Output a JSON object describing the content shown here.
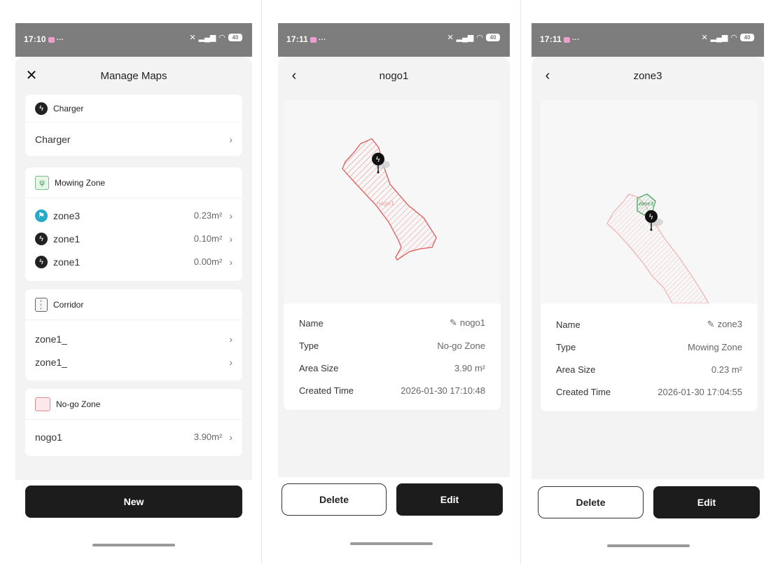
{
  "status_bar": {
    "panel1_time": "17:10",
    "panel2_time": "17:11",
    "panel3_time": "17:11",
    "dots": "···",
    "battery": "40"
  },
  "manage_maps": {
    "title": "Manage Maps",
    "charger": {
      "header": "Charger",
      "items": [
        {
          "label": "Charger"
        }
      ]
    },
    "mowing": {
      "header": "Mowing Zone",
      "items": [
        {
          "label": "zone3",
          "value": "0.23m²"
        },
        {
          "label": "zone1",
          "value": "0.10m²"
        },
        {
          "label": "zone1",
          "value": "0.00m²"
        }
      ]
    },
    "corridor": {
      "header": "Corridor",
      "items": [
        {
          "label": "zone1_"
        },
        {
          "label": "zone1_"
        }
      ]
    },
    "nogo": {
      "header": "No-go Zone",
      "items": [
        {
          "label": "nogo1",
          "value": "3.90m²"
        }
      ]
    },
    "new_button": "New"
  },
  "detail_nogo": {
    "title": "nogo1",
    "map_label": "nogo1",
    "fields": [
      {
        "label": "Name",
        "value": "nogo1"
      },
      {
        "label": "Type",
        "value": "No-go Zone"
      },
      {
        "label": "Area Size",
        "value": "3.90 m²"
      },
      {
        "label": "Created Time",
        "value": "2026-01-30 17:10:48"
      }
    ],
    "delete_button": "Delete",
    "edit_button": "Edit"
  },
  "detail_zone3": {
    "title": "zone3",
    "map_label": "zone3",
    "fields": [
      {
        "label": "Name",
        "value": "zone3"
      },
      {
        "label": "Type",
        "value": "Mowing Zone"
      },
      {
        "label": "Area Size",
        "value": "0.23 m²"
      },
      {
        "label": "Created Time",
        "value": "2026-01-30 17:04:55"
      }
    ],
    "delete_button": "Delete",
    "edit_button": "Edit"
  },
  "colors": {
    "nogo_stroke": "#e05a5a",
    "mowing_stroke": "#3d9d55",
    "primary": "#1c1c1c",
    "sheet_bg": "#f3f3f3"
  },
  "icons": {
    "close": "close-icon",
    "back": "back-arrow-icon",
    "chevron": "chevron-right-icon",
    "charger": "lightning-icon",
    "edit": "pencil-icon"
  }
}
